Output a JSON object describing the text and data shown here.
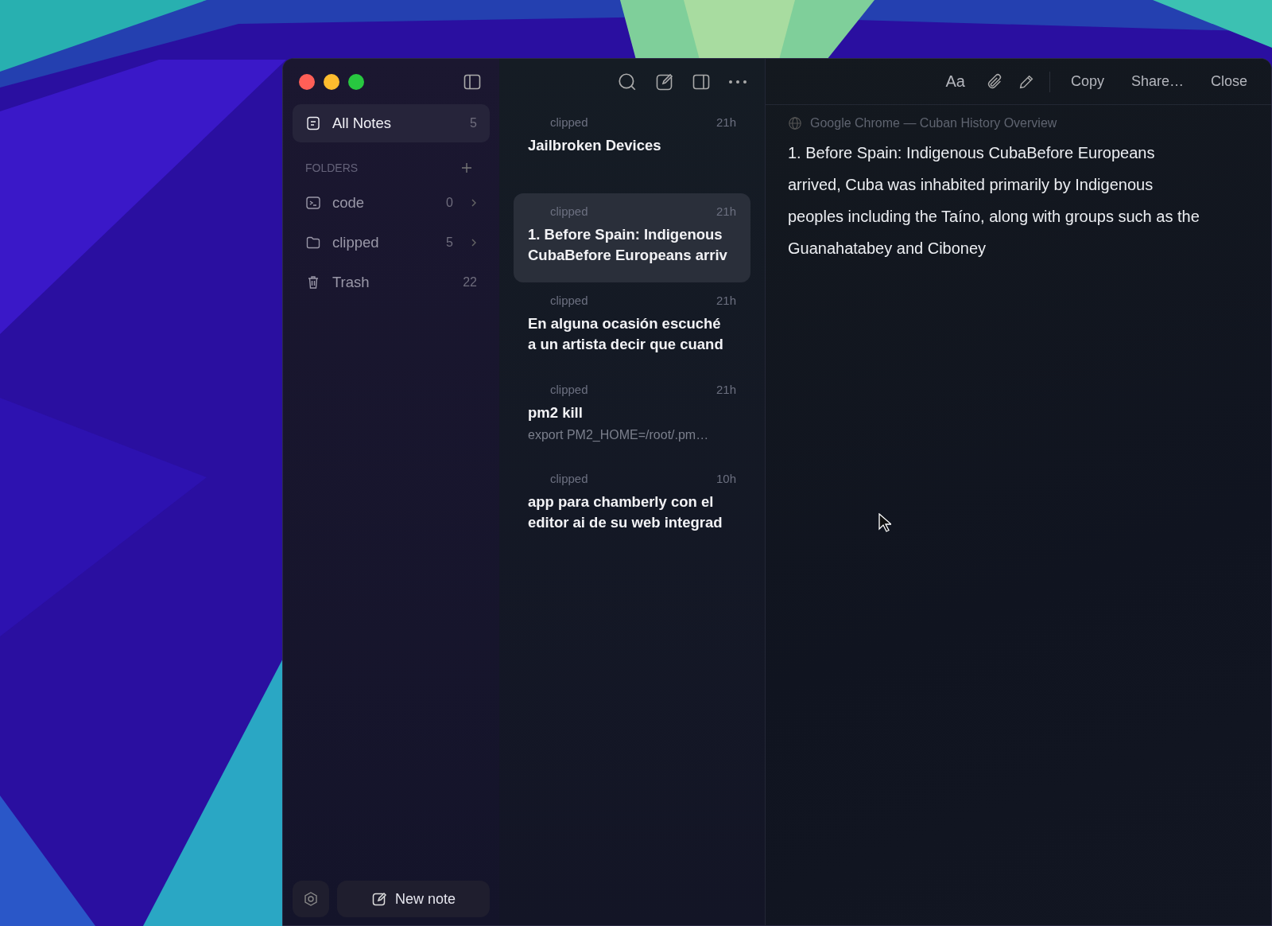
{
  "sidebar": {
    "nav": [
      {
        "kind": "notes",
        "label": "All Notes",
        "count": "5",
        "selected": true
      }
    ],
    "folders_heading": "FOLDERS",
    "folders": [
      {
        "kind": "terminal",
        "label": "code",
        "count": "0",
        "selected": false
      },
      {
        "kind": "folder",
        "label": "clipped",
        "count": "5",
        "selected": false
      },
      {
        "kind": "trash",
        "label": "Trash",
        "count": "22",
        "selected": false
      }
    ],
    "new_note": "New note"
  },
  "notes": [
    {
      "folder": "clipped",
      "time": "21h",
      "title_lines": [
        "Jailbroken Devices"
      ],
      "selected": false
    },
    {
      "folder": "clipped",
      "time": "21h",
      "title_lines": [
        "1. Before Spain: Indigenous",
        "CubaBefore Europeans arriv"
      ],
      "selected": true
    },
    {
      "folder": "clipped",
      "time": "21h",
      "title_lines": [
        "En alguna ocasión escuché",
        "a un artista decir que cuand"
      ],
      "selected": false
    },
    {
      "folder": "clipped",
      "time": "21h",
      "title_lines": [
        "pm2 kill"
      ],
      "preview": "export PM2_HOME=/root/.pm…",
      "selected": false
    },
    {
      "folder": "clipped",
      "time": "10h",
      "title_lines": [
        "app para chamberly con el",
        "editor ai de su web integrad"
      ],
      "selected": false
    }
  ],
  "editor": {
    "font_button": "Aa",
    "buttons": [
      "Copy",
      "Share…",
      "Close"
    ],
    "source": "Google Chrome — Cuban History Overview",
    "body": "1. Before Spain: Indigenous CubaBefore Europeans arrived, Cuba was inhabited primarily by Indigenous peoples including the Taíno, along with groups such as the Guanahatabey and Ciboney"
  }
}
